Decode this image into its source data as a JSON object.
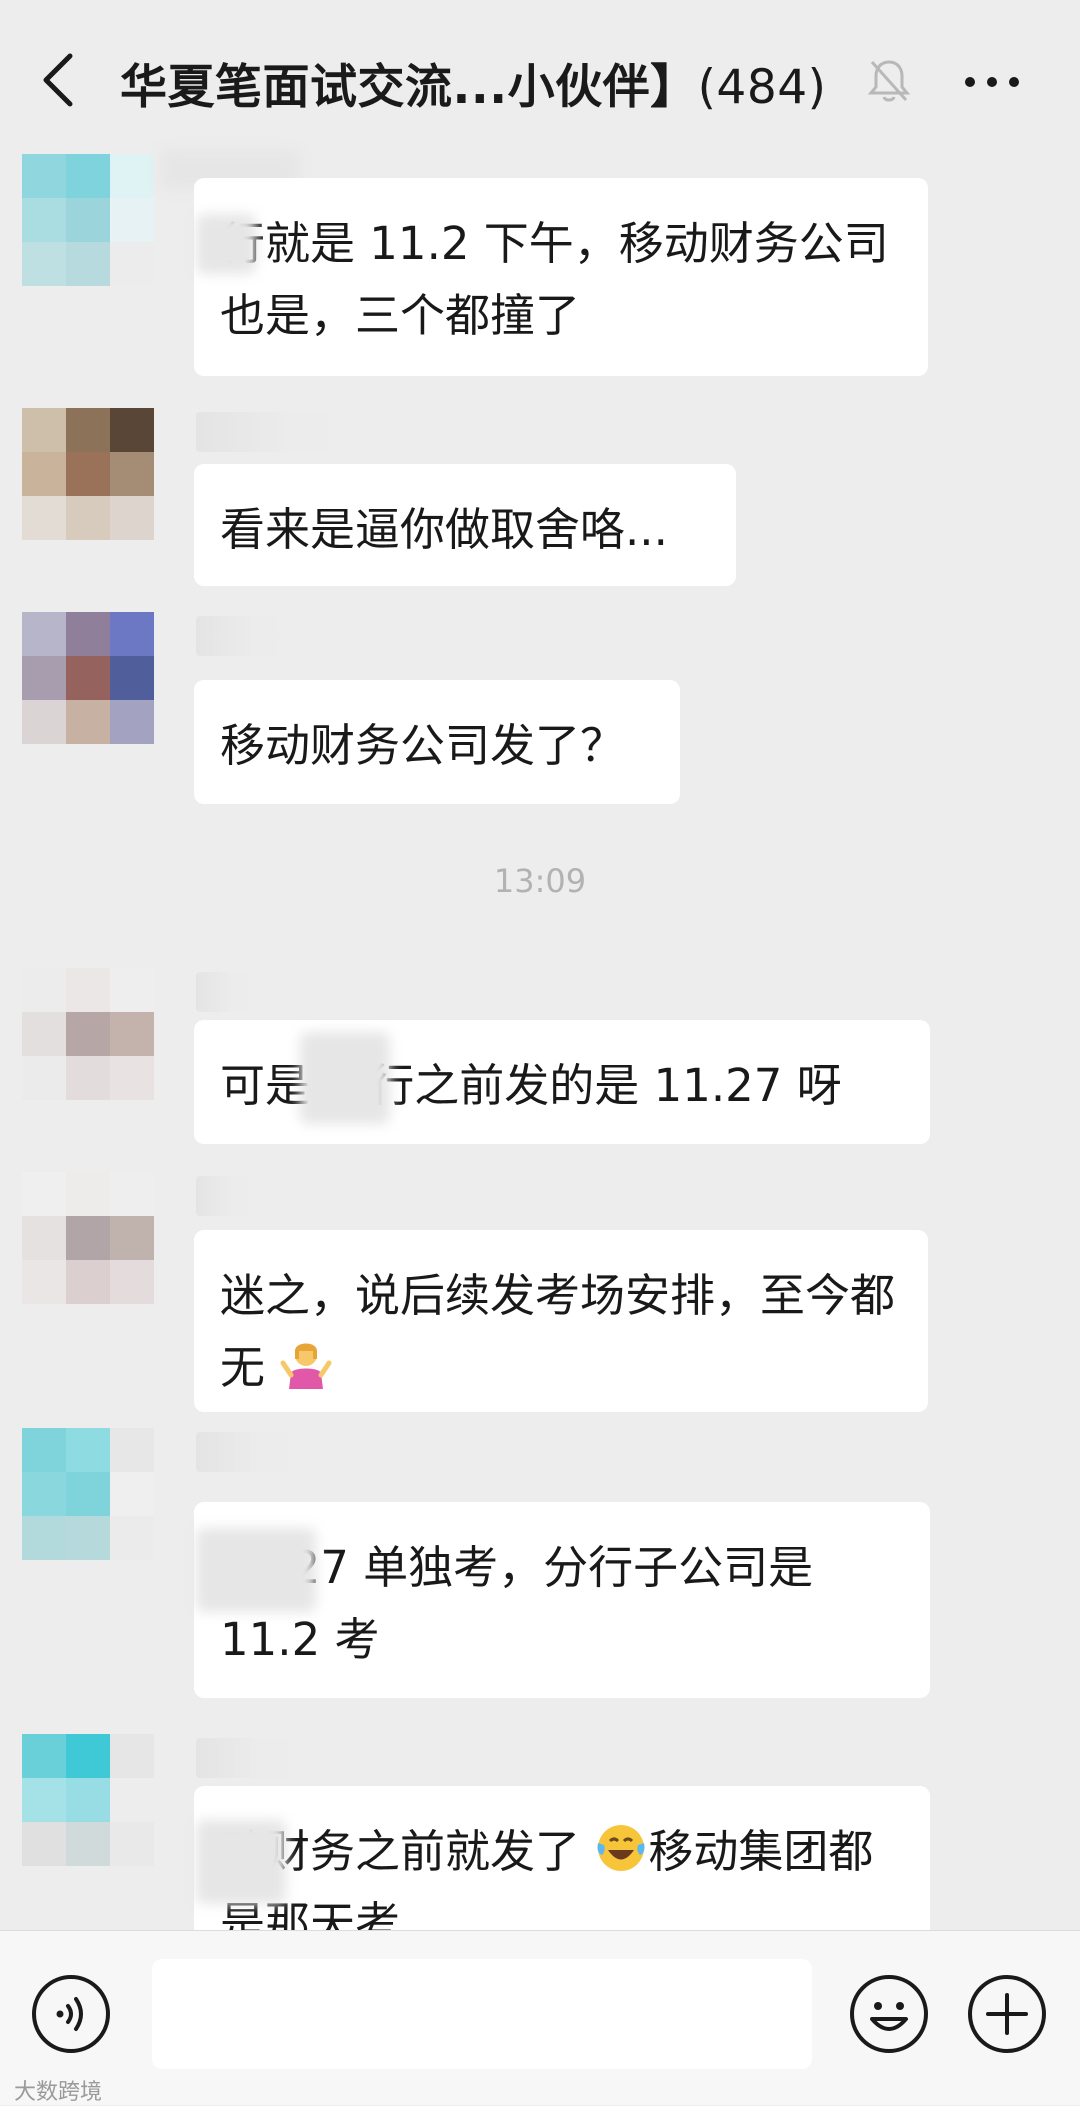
{
  "header": {
    "title": "华夏笔面试交流...小伙伴】",
    "count": "(484)",
    "back_icon": "chevron-left-icon",
    "mute_icon": "bell-off-icon",
    "more_icon": "more-dots-icon"
  },
  "messages": [
    {
      "text": "  行就是 11.2 下午，移动财务公司也是，三个都撞了"
    },
    {
      "text": "看来是逼你做取舍咯..."
    },
    {
      "text": "移动财务公司发了？"
    },
    {
      "text": "可是    总行之前发的是 11.27 呀"
    },
    {
      "text": "迷之，说后续发考场安排，至今都无"
    },
    {
      "text": "      11.27 单独考，分行子公司是 11.2 考"
    },
    {
      "text": "   动财务之前就发了",
      "text2": "移动集团都是那天考"
    }
  ],
  "timestamp": "13:09",
  "emojis": [
    "person-shrugging-icon",
    "laughing-tears-icon"
  ],
  "bottom_bar": {
    "voice_icon": "voice-icon",
    "emoji_icon": "smiley-icon",
    "plus_icon": "plus-circle-icon",
    "input_value": ""
  },
  "watermark": "大数跨境",
  "colors": {
    "background": "#ededed",
    "bubble": "#ffffff",
    "bar": "#f7f7f7"
  }
}
